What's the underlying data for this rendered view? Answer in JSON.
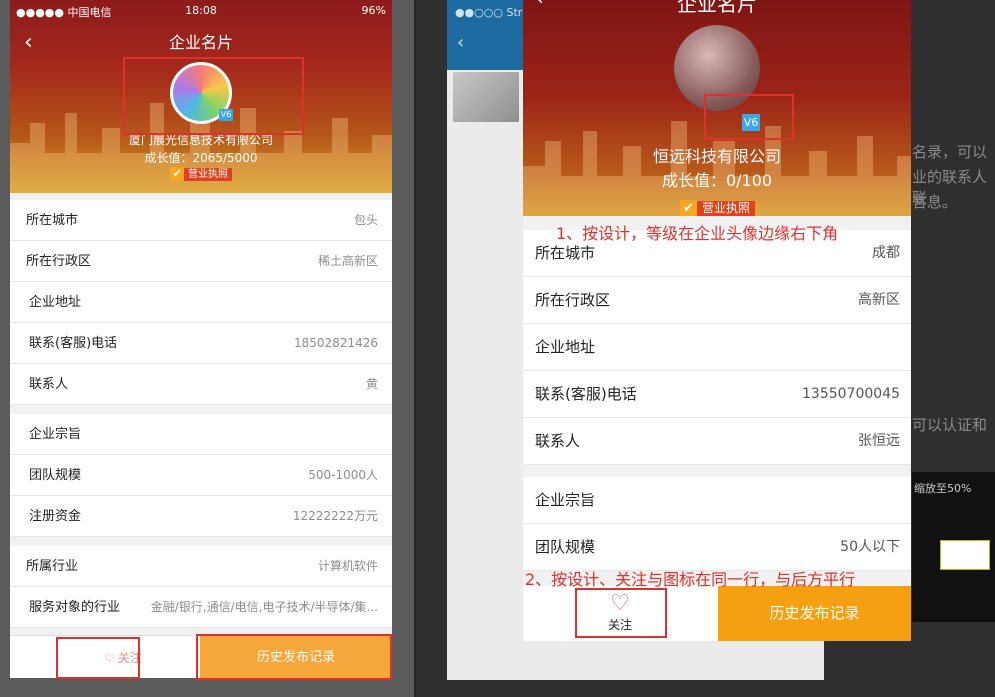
{
  "left_phone": {
    "status": {
      "carrier": "●●●●● 中国电信",
      "time": "18:08",
      "battery": "96%"
    },
    "nav": {
      "back_icon": "‹",
      "title": "企业名片"
    },
    "company": {
      "name": "厦门展光信息技术有限公司",
      "growth": "成长值：2065/5000",
      "level_badge": "V6",
      "license": "营业执照"
    },
    "group1": [
      {
        "label": "所在城市",
        "value": "包头"
      },
      {
        "label": "所在行政区",
        "value": "稀土高新区"
      },
      {
        "label": "企业地址",
        "value": ""
      },
      {
        "label": "联系(客服)电话",
        "value": "18502821426"
      },
      {
        "label": "联系人",
        "value": "黄"
      }
    ],
    "group2": [
      {
        "label": "企业宗旨",
        "value": ""
      },
      {
        "label": "团队规模",
        "value": "500-1000人"
      },
      {
        "label": "注册资金",
        "value": "12222222万元"
      }
    ],
    "group3": [
      {
        "label": "所属行业",
        "value": "计算机软件"
      },
      {
        "label": "服务对象的行业",
        "value": "金融/银行,通信/电信,电子技术/半导体/集..."
      }
    ],
    "bottom": {
      "follow_label": "关注",
      "history_label": "历史发布记录"
    }
  },
  "background_doc": {
    "title_fragment": "●●○○○ Stroke-",
    "side_texts": [
      "名录，可以",
      "业的联系人联",
      "言息。",
      "可以认证和"
    ],
    "thumb_caption": "缩放至50%"
  },
  "right_phone": {
    "nav": {
      "title": "企业名片"
    },
    "company": {
      "name": "恒远科技有限公司",
      "growth": "成长值：0/100",
      "level_badge": "V6",
      "license": "营业执照"
    },
    "group1": [
      {
        "label": "所在城市",
        "value": "成都"
      },
      {
        "label": "所在行政区",
        "value": "高新区"
      },
      {
        "label": "企业地址",
        "value": ""
      },
      {
        "label": "联系(客服)电话",
        "value": "13550700045"
      },
      {
        "label": "联系人",
        "value": "张恒远"
      }
    ],
    "group2": [
      {
        "label": "企业宗旨",
        "value": ""
      },
      {
        "label": "团队规模",
        "value": "50人以下"
      }
    ],
    "bottom": {
      "follow_label": "关注",
      "history_label": "历史发布记录"
    }
  },
  "annotations": {
    "note1": "1、按设计，等级在企业头像边缘右下角",
    "note2": "2、按设计、关注与图标在同一行，与后方平行"
  },
  "colors": {
    "accent_red": "#e0302d",
    "orange": "#f5a010",
    "header_red": "#9c2417"
  }
}
